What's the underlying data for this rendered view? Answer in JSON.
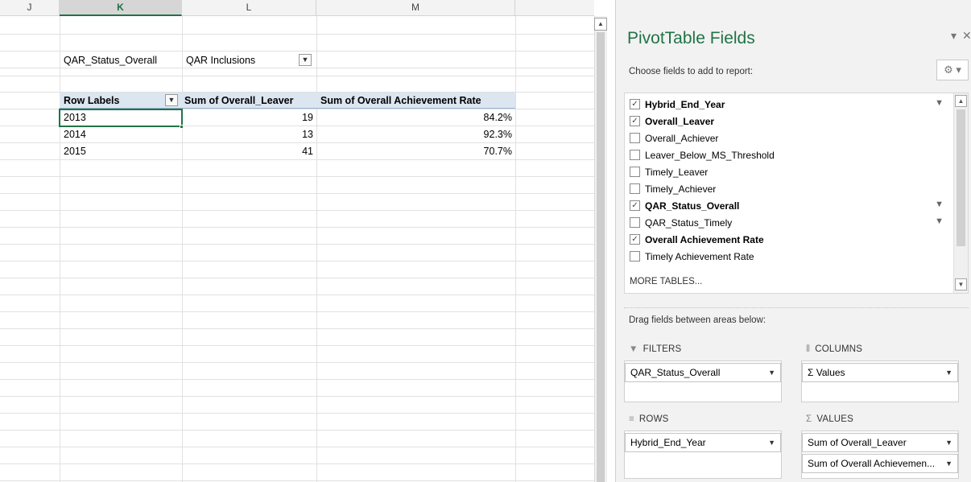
{
  "sheet": {
    "columns": [
      "J",
      "K",
      "L",
      "M"
    ],
    "active_column": "K",
    "pivot": {
      "filter_field": "QAR_Status_Overall",
      "filter_value": "QAR Inclusions",
      "headers": [
        "Row Labels",
        "Sum of Overall_Leaver",
        "Sum of Overall Achievement Rate"
      ],
      "rows": [
        {
          "label": "2013",
          "leaver": "19",
          "rate": "84.2%"
        },
        {
          "label": "2014",
          "leaver": "13",
          "rate": "92.3%"
        },
        {
          "label": "2015",
          "leaver": "41",
          "rate": "70.7%"
        }
      ]
    }
  },
  "pane": {
    "title": "PivotTable Fields",
    "subtitle": "Choose fields to add to report:",
    "fields": [
      {
        "label": "Hybrid_End_Year",
        "checked": true,
        "filtered": true
      },
      {
        "label": "Overall_Leaver",
        "checked": true,
        "filtered": false
      },
      {
        "label": "Overall_Achiever",
        "checked": false,
        "filtered": false
      },
      {
        "label": "Leaver_Below_MS_Threshold",
        "checked": false,
        "filtered": false
      },
      {
        "label": "Timely_Leaver",
        "checked": false,
        "filtered": false
      },
      {
        "label": "Timely_Achiever",
        "checked": false,
        "filtered": false
      },
      {
        "label": "QAR_Status_Overall",
        "checked": true,
        "filtered": true
      },
      {
        "label": "QAR_Status_Timely",
        "checked": false,
        "filtered": true
      },
      {
        "label": "Overall Achievement Rate",
        "checked": true,
        "filtered": false
      },
      {
        "label": "Timely Achievement Rate",
        "checked": false,
        "filtered": false
      }
    ],
    "more_tables": "MORE TABLES...",
    "drag_label": "Drag fields between areas below:",
    "areas": {
      "filters": {
        "title": "FILTERS",
        "items": [
          "QAR_Status_Overall"
        ]
      },
      "columns": {
        "title": "COLUMNS",
        "items": [
          "Σ  Values"
        ]
      },
      "rows": {
        "title": "ROWS",
        "items": [
          "Hybrid_End_Year"
        ]
      },
      "values": {
        "title": "VALUES",
        "items": [
          "Sum of Overall_Leaver",
          "Sum of Overall Achievemen..."
        ]
      }
    }
  }
}
